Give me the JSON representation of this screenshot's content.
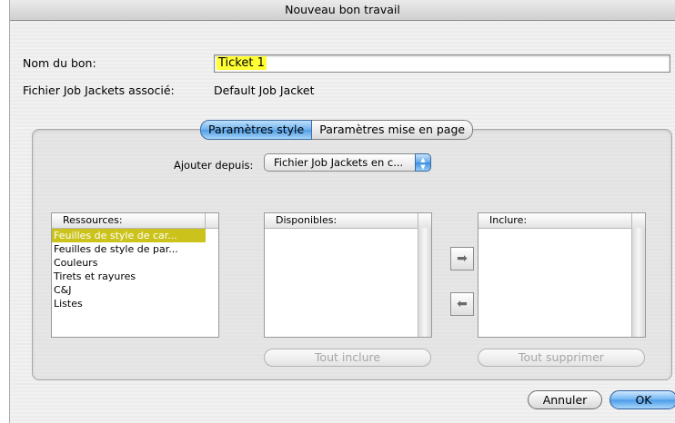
{
  "window": {
    "title": "Nouveau bon travail"
  },
  "form": {
    "name_label": "Nom du bon:",
    "name_value": "Ticket 1",
    "file_label": "Fichier Job Jackets associé:",
    "file_value": "Default Job Jacket"
  },
  "tabs": [
    {
      "label": "Paramètres style",
      "active": true
    },
    {
      "label": "Paramètres mise en page",
      "active": false
    }
  ],
  "add_from": {
    "label": "Ajouter depuis:",
    "selected": "Fichier Job Jackets en c..."
  },
  "resources": {
    "header": "Ressources:",
    "items": [
      "Feuilles de style de car...",
      "Feuilles de style de par...",
      "Couleurs",
      "Tirets et rayures",
      "C&J",
      "Listes"
    ],
    "selected_index": 0
  },
  "available": {
    "header": "Disponibles:",
    "button": "Tout inclure"
  },
  "include": {
    "header": "Inclure:",
    "button": "Tout supprimer"
  },
  "arrows": {
    "add_icon": "arrow-right-icon",
    "remove_icon": "arrow-left-icon"
  },
  "buttons": {
    "cancel": "Annuler",
    "ok": "OK"
  },
  "colors": {
    "selection_highlight": "#ffff33",
    "list_selection": "#cbc31b",
    "aqua_blue": "#4a9be9"
  }
}
